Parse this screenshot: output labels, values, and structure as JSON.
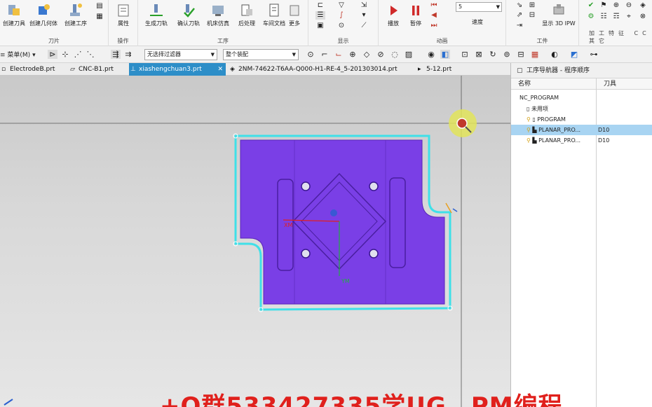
{
  "ribbon": {
    "buttons": [
      {
        "label": "创建刀具",
        "icon": "create-tool-icon"
      },
      {
        "label": "创建几何体",
        "icon": "create-geometry-icon"
      },
      {
        "label": "创建工序",
        "icon": "create-operation-icon"
      },
      {
        "label": "属性",
        "icon": "properties-icon"
      },
      {
        "label": "生成刀轨",
        "icon": "generate-toolpath-icon"
      },
      {
        "label": "确认刀轨",
        "icon": "verify-toolpath-icon"
      },
      {
        "label": "机床仿真",
        "icon": "machine-simulation-icon"
      },
      {
        "label": "后处理",
        "icon": "postprocess-icon"
      },
      {
        "label": "车间文档",
        "icon": "shop-docs-icon"
      },
      {
        "label": "更多",
        "icon": "more-icon"
      },
      {
        "label": "播放",
        "icon": "play-icon"
      },
      {
        "label": "暂停",
        "icon": "pause-icon"
      }
    ],
    "groups": [
      "刀片",
      "操作",
      "工序",
      "显示",
      "动画",
      "工件",
      "加工特征",
      "CC",
      "其它"
    ],
    "speed_value": "5",
    "speed_label": "速度",
    "ipw_label": "显示 3D IPW"
  },
  "toolbar": {
    "menu_label": "菜单(M)",
    "filter_combo": "无选择过滤器",
    "assembly_combo": "整个装配"
  },
  "tabs": [
    {
      "label": "ElectrodeB.prt",
      "active": false
    },
    {
      "label": "CNC-B1.prt",
      "active": false
    },
    {
      "label": "xiashengchuan3.prt",
      "active": true
    },
    {
      "label": "2NM-74622-T6AA-Q000-H1-RE-4_5-201303014.prt",
      "active": false
    },
    {
      "label": "5-12.prt",
      "active": false
    }
  ],
  "viewport": {
    "axis_x_label": "XM",
    "axis_y_label": "YM",
    "part_color": "#7a3fe6",
    "boundary_color": "#3fe0e8"
  },
  "navigator": {
    "title": "工序导航器 - 程序顺序",
    "col_name": "名称",
    "col_tool": "刀具",
    "rows": [
      {
        "name": "NC_PROGRAM",
        "tool": "",
        "selected": false,
        "indent": 0
      },
      {
        "name": "未用项",
        "tool": "",
        "selected": false,
        "indent": 1
      },
      {
        "name": "PROGRAM",
        "tool": "",
        "selected": false,
        "indent": 1
      },
      {
        "name": "PLANAR_PRO...",
        "tool": "D10",
        "selected": true,
        "indent": 2
      },
      {
        "name": "PLANAR_PRO...",
        "tool": "D10",
        "selected": false,
        "indent": 2
      }
    ]
  },
  "watermark": "+Q群533427335学UG，PM编程"
}
